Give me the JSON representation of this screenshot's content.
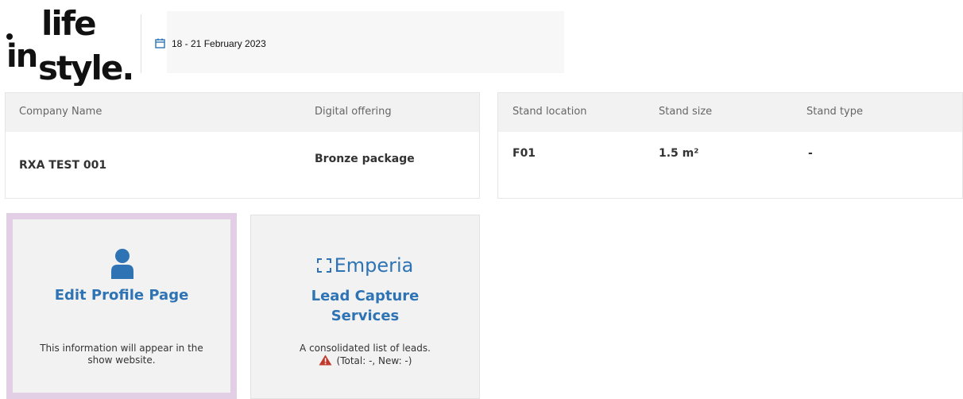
{
  "header": {
    "logo_text_line1": "life",
    "logo_text_prefix": "in",
    "logo_text_line2": "style.",
    "date_range": "18 - 21 February 2023"
  },
  "company_info": {
    "columns": [
      "Company Name",
      "Digital offering"
    ],
    "values": [
      "RXA TEST 001",
      "Bronze package"
    ]
  },
  "stand_info": {
    "columns": [
      "Stand location",
      "Stand size",
      "Stand type"
    ],
    "values": [
      "F01",
      "1.5 m²",
      "-"
    ]
  },
  "tiles": {
    "profile": {
      "title": "Edit Profile Page",
      "description_line1": "This information will appear in the",
      "description_line2": "show website.",
      "icon": "user-icon"
    },
    "leads": {
      "brand": "Emperia",
      "title_line1": "Lead Capture",
      "title_line2": "Services",
      "description_line1": "A consolidated list of leads.",
      "status": "(Total: -, New: -)",
      "icon": "warning-icon"
    }
  },
  "colors": {
    "accent": "#2e74b5",
    "highlight_border": "#e2cfe6",
    "warning": "#c0392b",
    "panel_bg": "#f2f2f2"
  }
}
